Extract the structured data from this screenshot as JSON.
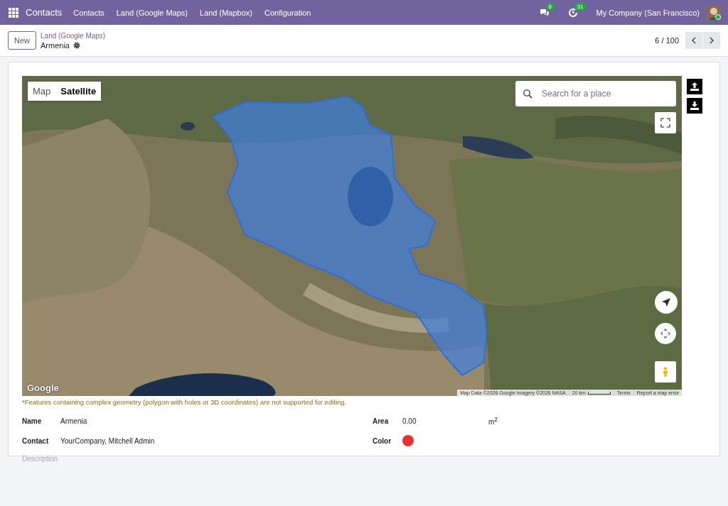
{
  "navbar": {
    "app_name": "Contacts",
    "menu": [
      "Contacts",
      "Land (Google Maps)",
      "Land (Mapbox)",
      "Configuration"
    ],
    "messages_count": "6",
    "activities_count": "31",
    "company": "My Company (San Francisco)"
  },
  "control_panel": {
    "new_button": "New",
    "breadcrumb": "Land (Google Maps)",
    "record_title": "Armenia",
    "pager": "6 / 100"
  },
  "map": {
    "type_toggle": [
      {
        "label": "Map",
        "selected": false
      },
      {
        "label": "Satellite",
        "selected": true
      }
    ],
    "search": {
      "placeholder": "Search for a place"
    },
    "google_logo": "Google",
    "attribution": [
      "Map Data ©2026 Google Imagery ©2026 NASA",
      "20 km",
      "Terms",
      "Report a map error"
    ]
  },
  "warning": "*Features containing complex geometry (polygon with holes or 3D coordinates) are not supported for editing.",
  "fields": [
    {
      "label": "Name",
      "value": "Armenia"
    },
    {
      "label": "Contact",
      "value": "YourCompany, Mitchell Admin"
    }
  ],
  "area": {
    "label": "Area",
    "value": "0.00",
    "unit": "m$^{2}$"
  },
  "color": {
    "label": "Color",
    "color": "#e8312f"
  },
  "description": {
    "placeholder": "Description"
  }
}
